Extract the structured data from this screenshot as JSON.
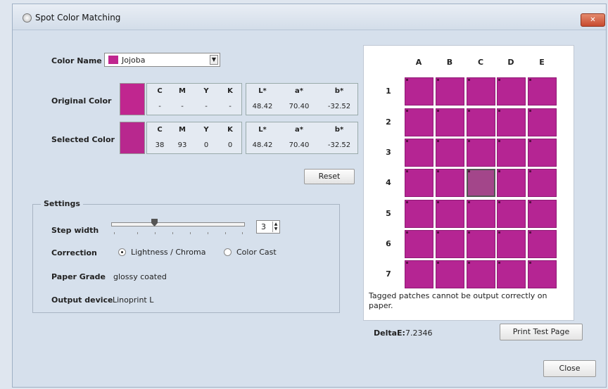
{
  "window": {
    "title": "Spot Color Matching"
  },
  "color_name": {
    "label": "Color Name",
    "value": "Jojoba",
    "swatch_color": "#c0268f"
  },
  "original_color": {
    "label": "Original Color",
    "swatch_color": "#c0268f",
    "cmyk_headers": [
      "C",
      "M",
      "Y",
      "K"
    ],
    "cmyk_values": [
      "-",
      "-",
      "-",
      "-"
    ],
    "lab_headers": [
      "L*",
      "a*",
      "b*"
    ],
    "lab_values": [
      "48.42",
      "70.40",
      "-32.52"
    ]
  },
  "selected_color": {
    "label": "Selected Color",
    "swatch_color": "#b8288e",
    "cmyk_headers": [
      "C",
      "M",
      "Y",
      "K"
    ],
    "cmyk_values": [
      "38",
      "93",
      "0",
      "0"
    ],
    "lab_headers": [
      "L*",
      "a*",
      "b*"
    ],
    "lab_values": [
      "48.42",
      "70.40",
      "-32.52"
    ]
  },
  "reset_label": "Reset",
  "settings": {
    "title": "Settings",
    "step_width_label": "Step width",
    "step_width_value": "3",
    "correction_label": "Correction",
    "correction_options": [
      "Lightness / Chroma",
      "Color Cast"
    ],
    "correction_selected": "Lightness / Chroma",
    "paper_grade_label": "Paper Grade",
    "paper_grade_value": "glossy coated",
    "output_device_label": "Output device",
    "output_device_value": "Linoprint L"
  },
  "grid": {
    "columns": [
      "A",
      "B",
      "C",
      "D",
      "E"
    ],
    "rows": [
      "1",
      "2",
      "3",
      "4",
      "5",
      "6",
      "7"
    ],
    "selected_patch": "C4",
    "patch_color": "#b52593",
    "note": "Tagged patches cannot be output correctly on paper."
  },
  "delta_e": {
    "label": "DeltaE:",
    "value": "7.2346"
  },
  "print_test_page_label": "Print Test Page",
  "close_label": "Close"
}
